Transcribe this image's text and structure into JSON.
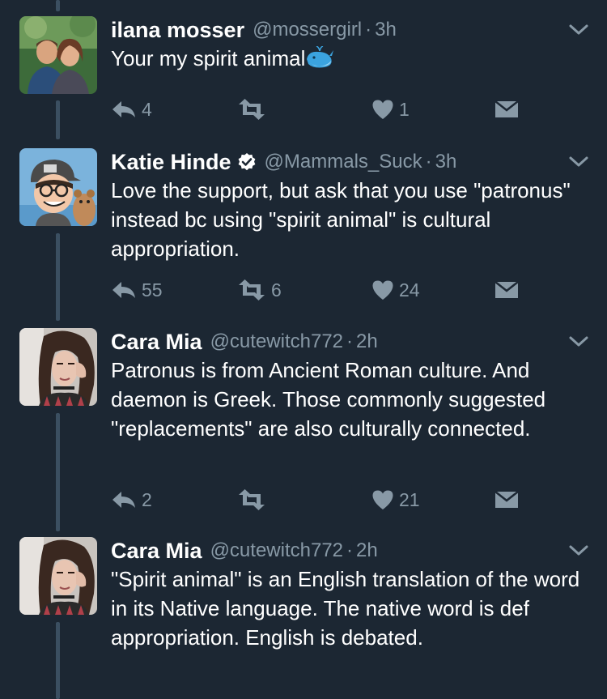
{
  "tweets": [
    {
      "name": "ilana mosser",
      "handle": "@mossergirl",
      "separator": "·",
      "time": "3h",
      "verified": false,
      "text": "Your my spirit animal",
      "emoji": "whale-emoji",
      "reply_count": "4",
      "retweet_count": "",
      "like_count": "1",
      "avatar": "couple-photo-avatar"
    },
    {
      "name": "Katie Hinde",
      "handle": "@Mammals_Suck",
      "separator": "·",
      "time": "3h",
      "verified": true,
      "text": "Love the support, but ask that you use \"patronus\" instead bc using \"spirit animal\" is cultural appropriation.",
      "reply_count": "55",
      "retweet_count": "6",
      "like_count": "24",
      "avatar": "cartoon-avatar"
    },
    {
      "name": "Cara Mia",
      "handle": "@cutewitch772",
      "separator": "·",
      "time": "2h",
      "verified": false,
      "text": "Patronus is from Ancient Roman culture. And daemon is Greek. Those commonly suggested \"replacements\" are also culturally connected.",
      "reply_count": "2",
      "retweet_count": "",
      "like_count": "21",
      "avatar": "selfie-avatar"
    },
    {
      "name": "Cara Mia",
      "handle": "@cutewitch772",
      "separator": "·",
      "time": "2h",
      "verified": false,
      "text": "\"Spirit animal\" is an English translation of the word in its Native language. The native word is def appropriation. English is debated.",
      "avatar": "selfie-avatar"
    }
  ],
  "colors": {
    "background": "#1c2733",
    "thread_line": "#3b4f61",
    "secondary_text": "#8899a6",
    "primary_text": "#ffffff",
    "verified_badge": "#ffffff"
  }
}
